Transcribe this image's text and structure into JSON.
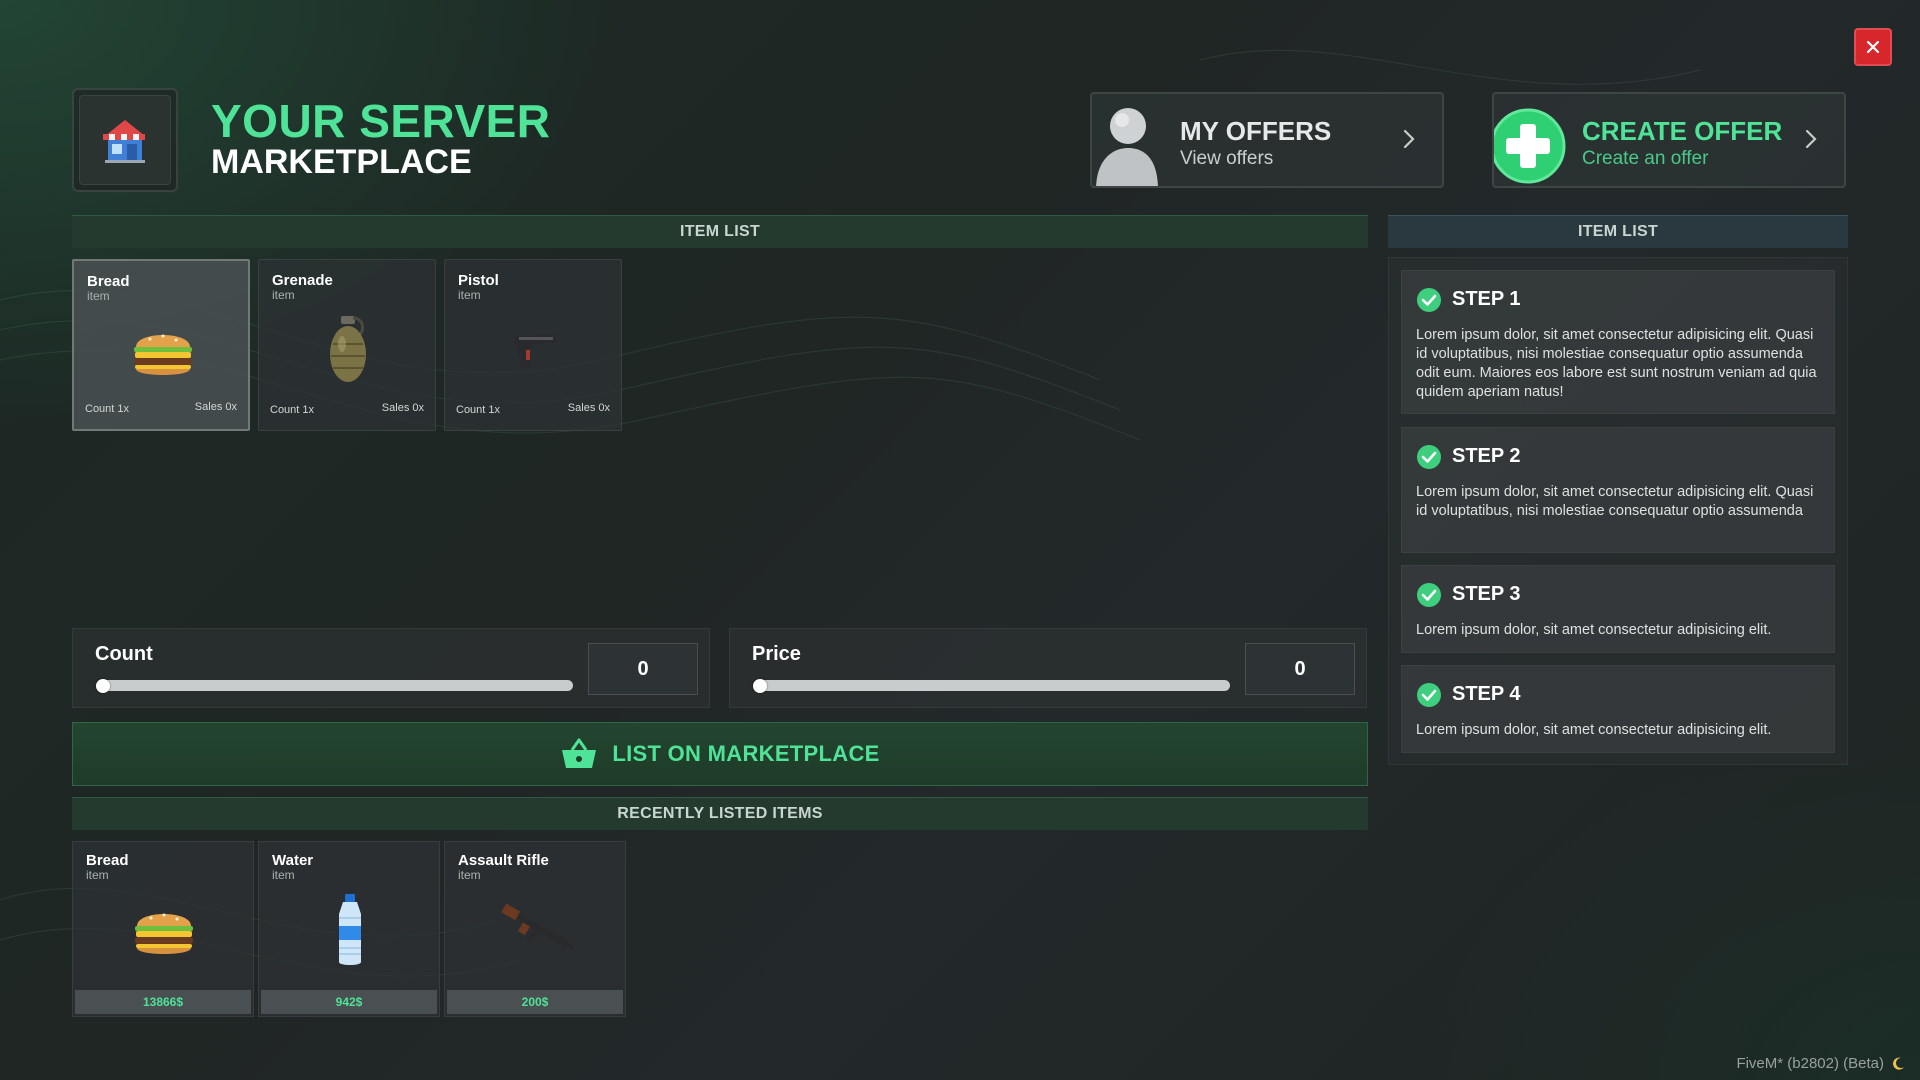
{
  "header": {
    "title_part1": "YOUR",
    "title_part2": "SERVER",
    "subtitle": "MARKETPLACE",
    "logo_icon": "store-icon"
  },
  "actions": {
    "my_offers": {
      "title": "MY OFFERS",
      "subtitle": "View offers",
      "icon": "user-avatar-icon"
    },
    "create_offer": {
      "title": "CREATE OFFER",
      "subtitle": "Create an offer",
      "icon": "plus-circle-icon"
    }
  },
  "item_list": {
    "header": "ITEM LIST",
    "items": [
      {
        "name": "Bread",
        "type": "item",
        "count": "Count 1x",
        "sales": "Sales 0x",
        "icon": "burger-icon",
        "selected": true
      },
      {
        "name": "Grenade",
        "type": "item",
        "count": "Count 1x",
        "sales": "Sales 0x",
        "icon": "grenade-icon",
        "selected": false
      },
      {
        "name": "Pistol",
        "type": "item",
        "count": "Count 1x",
        "sales": "Sales 0x",
        "icon": "pistol-icon",
        "selected": false
      }
    ]
  },
  "count_slider": {
    "label": "Count",
    "value": "0",
    "fraction": 0
  },
  "price_slider": {
    "label": "Price",
    "value": "0",
    "fraction": 0
  },
  "list_button": {
    "label": "LIST ON MARKETPLACE",
    "icon": "basket-icon"
  },
  "recent": {
    "header": "RECENTLY LISTED ITEMS",
    "items": [
      {
        "name": "Bread",
        "type": "item",
        "price": "13866$",
        "icon": "burger-icon"
      },
      {
        "name": "Water",
        "type": "item",
        "price": "942$",
        "icon": "water-bottle-icon"
      },
      {
        "name": "Assault Rifle",
        "type": "item",
        "price": "200$",
        "icon": "rifle-icon"
      }
    ]
  },
  "steps": {
    "header": "ITEM LIST",
    "items": [
      {
        "title": "STEP 1",
        "desc": "Lorem ipsum dolor, sit amet consectetur adipisicing elit. Quasi id voluptatibus, nisi molestiae consequatur optio assumenda odit eum. Maiores eos labore est sunt nostrum veniam ad quia quidem aperiam natus!"
      },
      {
        "title": "STEP 2",
        "desc": "Lorem ipsum dolor, sit amet consectetur adipisicing elit. Quasi id voluptatibus, nisi molestiae consequatur optio assumenda"
      },
      {
        "title": "STEP 3",
        "desc": "Lorem ipsum dolor, sit amet consectetur adipisicing elit."
      },
      {
        "title": "STEP 4",
        "desc": "Lorem ipsum dolor, sit amet consectetur adipisicing elit."
      }
    ]
  },
  "footer": {
    "build": "FiveM* (b2802) (Beta)"
  },
  "colors": {
    "accent": "#4fe398",
    "close": "#d7262c"
  }
}
